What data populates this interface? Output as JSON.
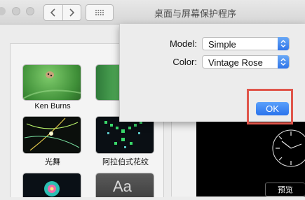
{
  "window": {
    "title": "桌面与屏幕保护程序"
  },
  "toolbar": {
    "back_icon": "chevron-left",
    "forward_icon": "chevron-right",
    "grid_icon": "grid-dots"
  },
  "savers": [
    {
      "label": "Ken Burns"
    },
    {
      "label": ""
    },
    {
      "label": "光舞"
    },
    {
      "label": "阿拉伯式花纹"
    },
    {
      "label": ""
    },
    {
      "label": "Aa"
    }
  ],
  "options_sheet": {
    "model_label": "Model:",
    "model_value": "Simple",
    "color_label": "Color:",
    "color_value": "Vintage Rose",
    "ok_label": "OK",
    "highlight_color": "#e0564b",
    "accent_color": "#2f74e8"
  },
  "preview": {
    "button_label": "预览"
  }
}
